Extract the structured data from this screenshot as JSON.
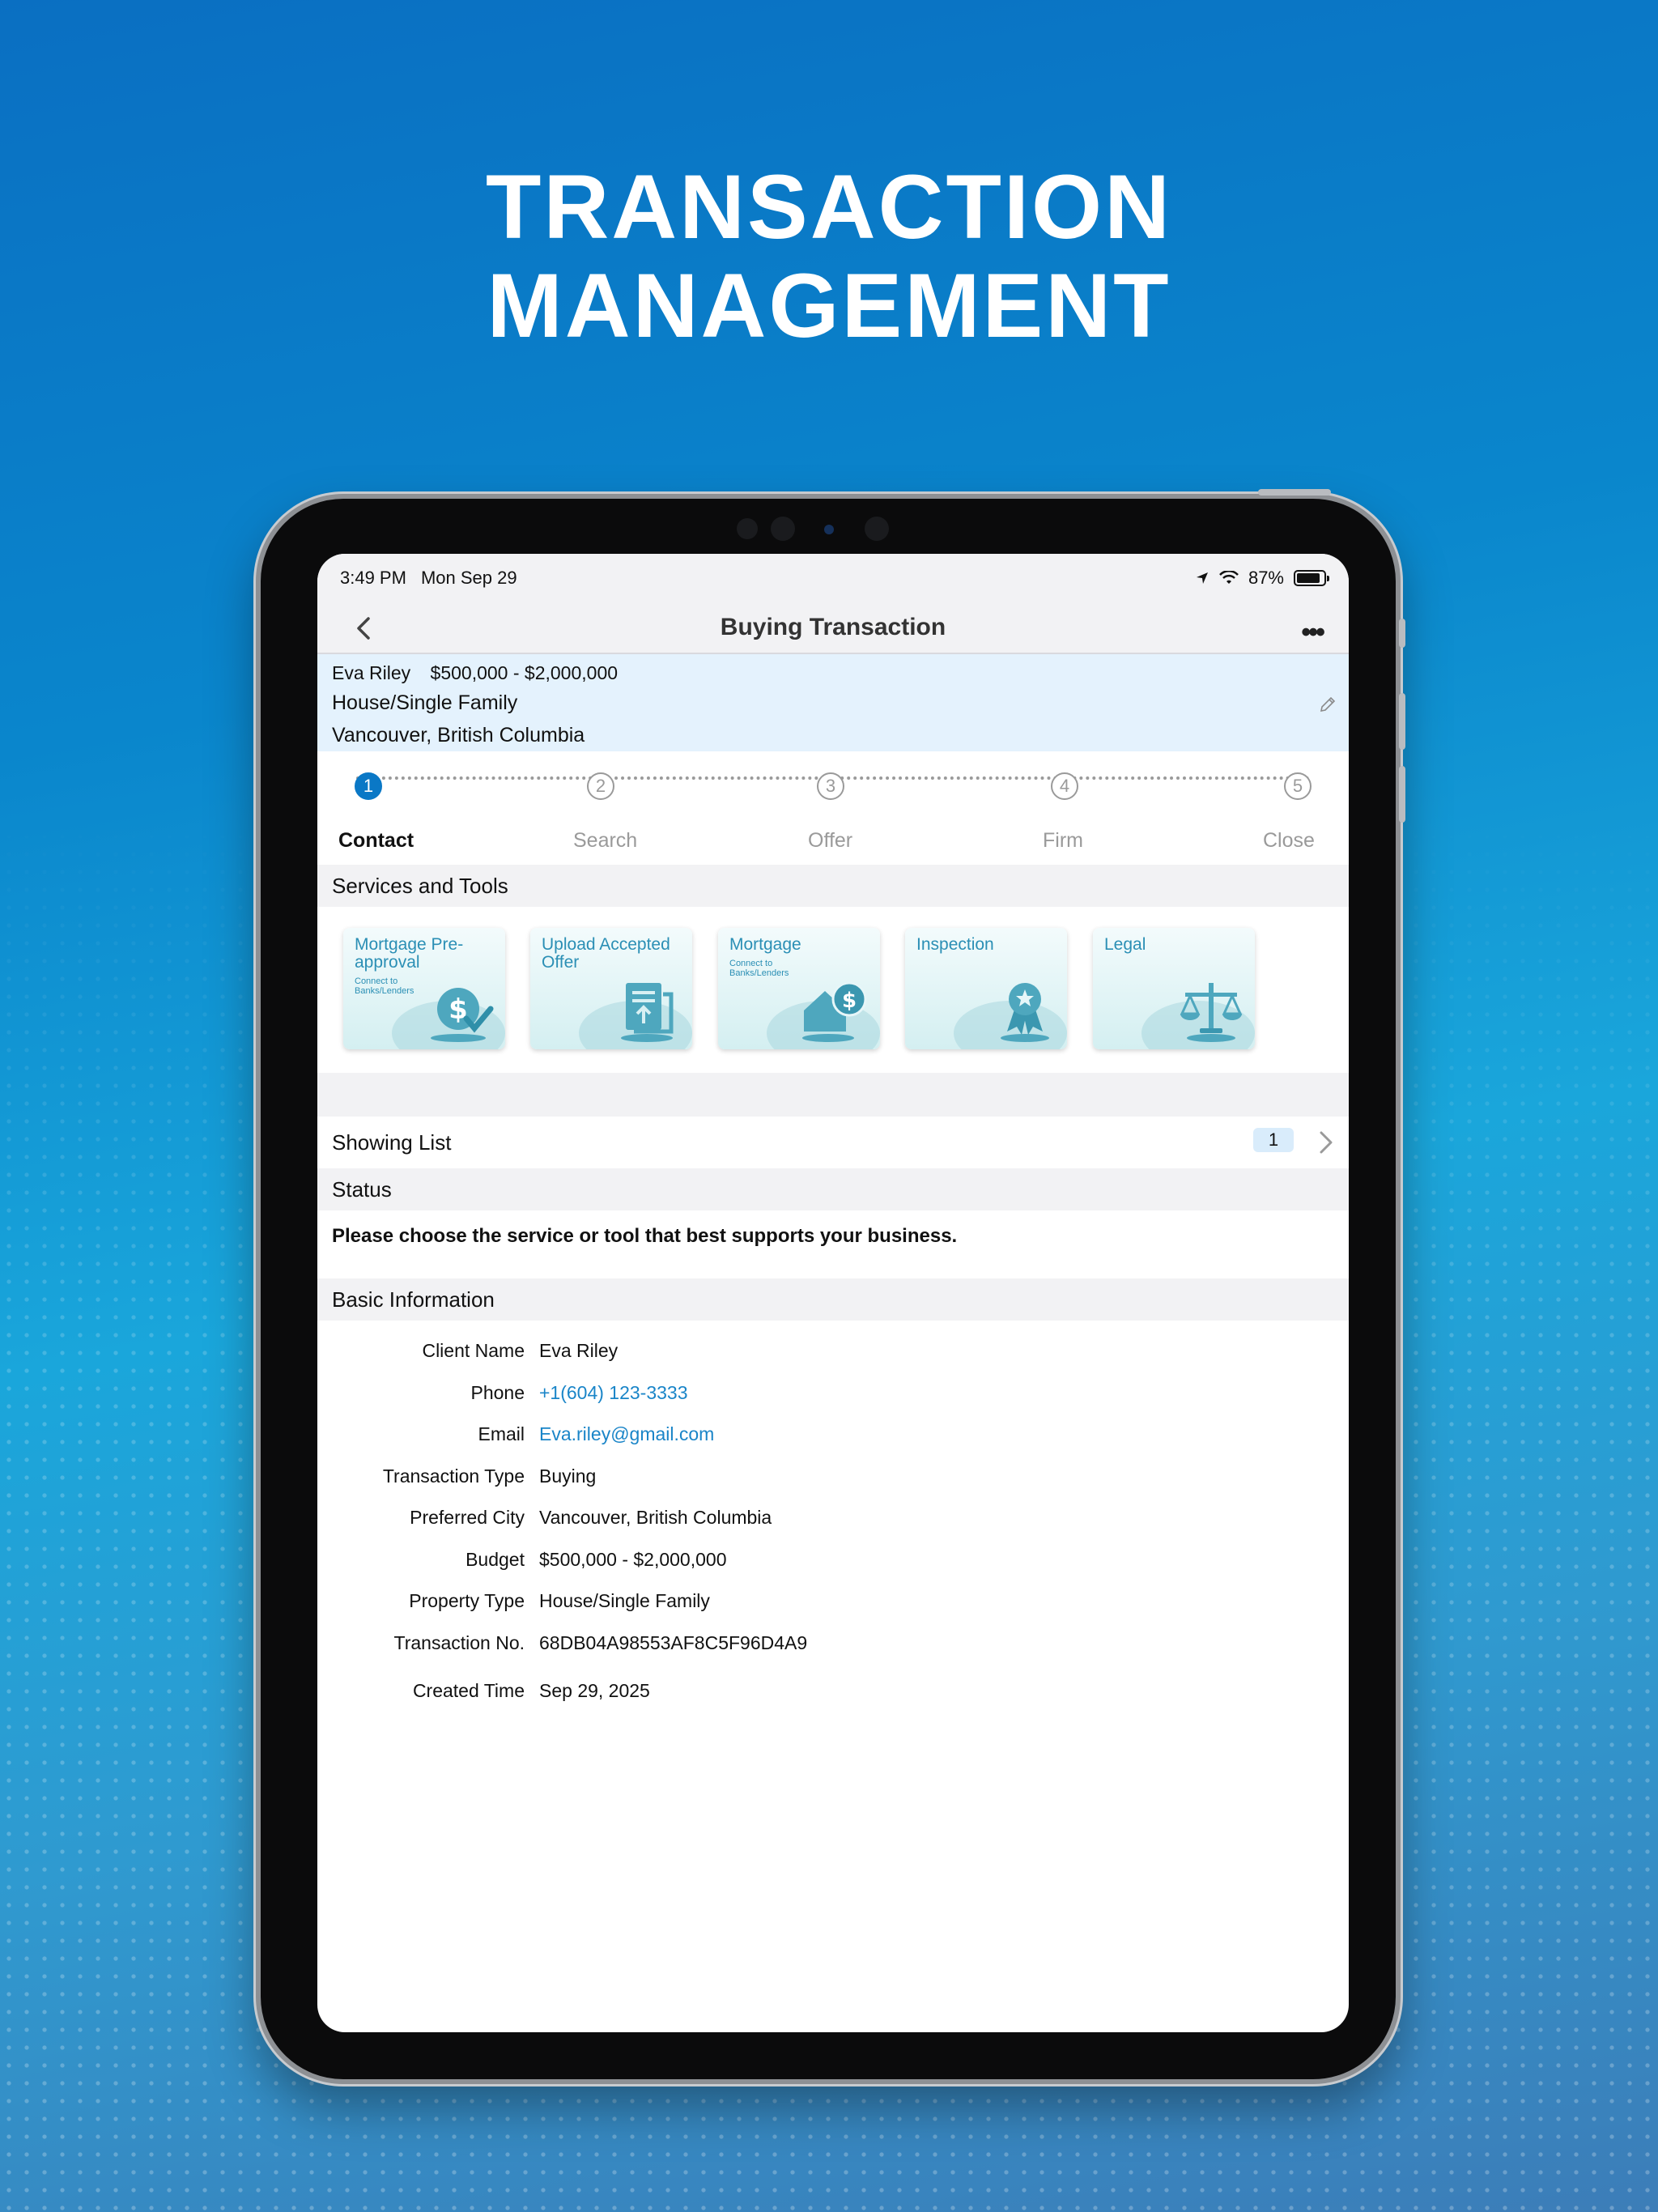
{
  "headline": {
    "line1": "TRANSACTION",
    "line2": "MANAGEMENT"
  },
  "statusbar": {
    "time": "3:49 PM",
    "date": "Mon Sep 29",
    "battery": "87%"
  },
  "nav": {
    "title": "Buying Transaction"
  },
  "summary": {
    "client": "Eva Riley",
    "budget": "$500,000 - $2,000,000",
    "property_type": "House/Single Family",
    "city": "Vancouver, British Columbia"
  },
  "steps": [
    {
      "num": "1",
      "label": "Contact",
      "active": true
    },
    {
      "num": "2",
      "label": "Search",
      "active": false
    },
    {
      "num": "3",
      "label": "Offer",
      "active": false
    },
    {
      "num": "4",
      "label": "Firm",
      "active": false
    },
    {
      "num": "5",
      "label": "Close",
      "active": false
    }
  ],
  "services": {
    "heading": "Services and Tools",
    "tools": [
      {
        "title": "Mortgage Pre-approval",
        "sub": "Connect to Banks/Lenders",
        "icon": "dollar-check-icon"
      },
      {
        "title": "Upload Accepted Offer",
        "sub": "",
        "icon": "document-upload-icon"
      },
      {
        "title": "Mortgage",
        "sub": "Connect to Banks/Lenders",
        "icon": "house-dollar-icon"
      },
      {
        "title": "Inspection",
        "sub": "",
        "icon": "award-ribbon-icon"
      },
      {
        "title": "Legal",
        "sub": "",
        "icon": "scales-icon"
      }
    ]
  },
  "showing": {
    "label": "Showing List",
    "count": "1"
  },
  "status": {
    "heading": "Status",
    "text": "Please choose the service or tool that best supports your business."
  },
  "basic": {
    "heading": "Basic Information",
    "rows": [
      {
        "key": "Client Name",
        "value": "Eva Riley"
      },
      {
        "key": "Phone",
        "value": "+1(604) 123-3333"
      },
      {
        "key": "Email",
        "value": "Eva.riley@gmail.com"
      },
      {
        "key": "Transaction Type",
        "value": "Buying"
      },
      {
        "key": "Preferred City",
        "value": "Vancouver, British Columbia"
      },
      {
        "key": "Budget",
        "value": "$500,000 - $2,000,000"
      },
      {
        "key": "Property Type",
        "value": "House/Single Family"
      },
      {
        "key": "Transaction No.",
        "value": "68DB04A98553AF8C5F96D4A9"
      },
      {
        "key": "Created Time",
        "value": "Sep 29, 2025"
      }
    ]
  },
  "colors": {
    "accent": "#0a78c6",
    "link": "#1a85c8",
    "summary_bg": "#e4f2fd",
    "section_bg": "#f2f2f4"
  }
}
